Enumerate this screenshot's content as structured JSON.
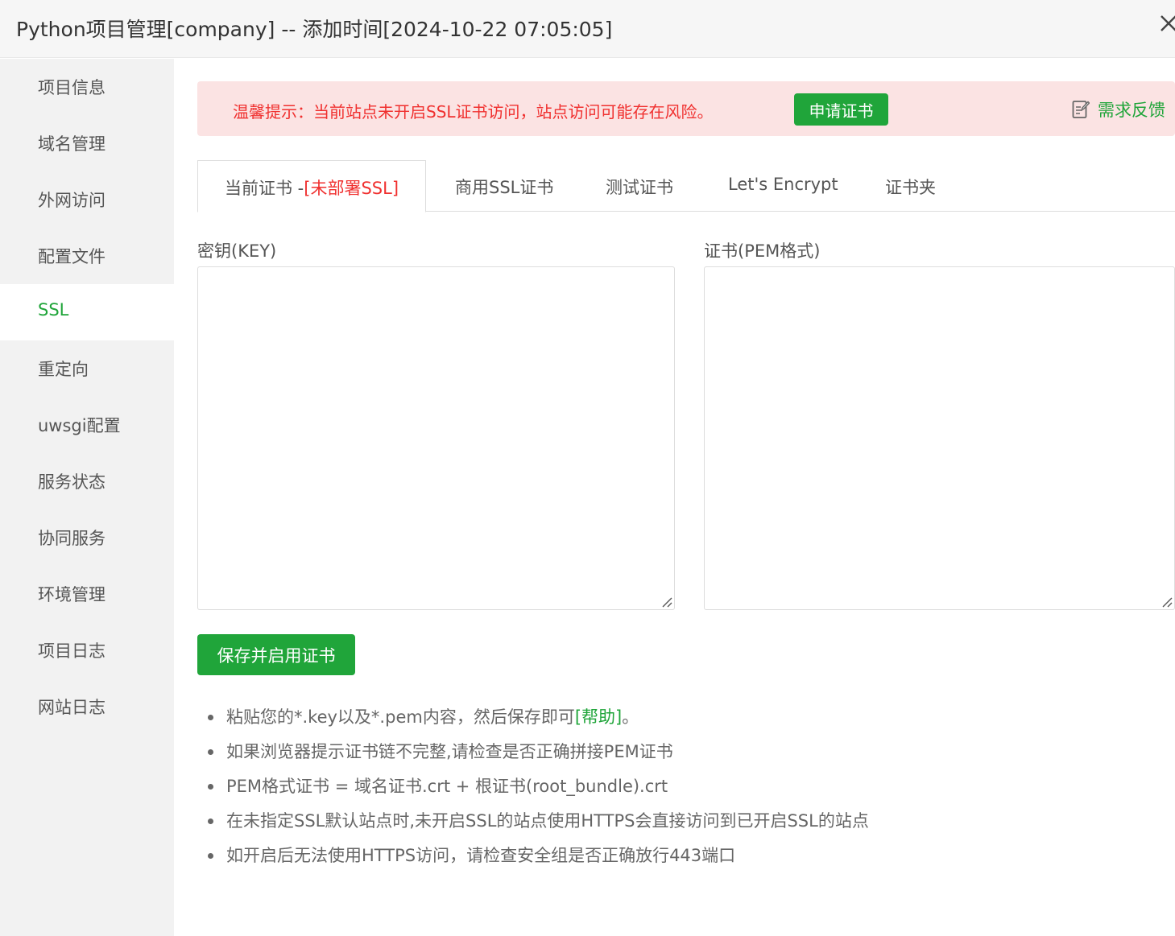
{
  "window": {
    "title": "Python项目管理[company] -- 添加时间[2024-10-22 07:05:05]",
    "close_icon": "close-icon"
  },
  "sidebar": {
    "active": "SSL",
    "items": [
      {
        "label": "项目信息"
      },
      {
        "label": "域名管理"
      },
      {
        "label": "外网访问"
      },
      {
        "label": "配置文件"
      },
      {
        "label": "SSL"
      },
      {
        "label": "重定向"
      },
      {
        "label": "uwsgi配置"
      },
      {
        "label": "服务状态"
      },
      {
        "label": "协同服务"
      },
      {
        "label": "环境管理"
      },
      {
        "label": "项目日志"
      },
      {
        "label": "网站日志"
      }
    ]
  },
  "alert": {
    "text": "温馨提示：当前站点未开启SSL证书访问，站点访问可能存在风险。",
    "apply_button": "申请证书",
    "feedback_label": "需求反馈",
    "feedback_icon": "edit-note-icon"
  },
  "tabs": {
    "current_label": "当前证书 -",
    "current_status": "[未部署SSL]",
    "items": [
      {
        "label": "商用SSL证书"
      },
      {
        "label": "测试证书"
      },
      {
        "label": "Let's Encrypt"
      },
      {
        "label": "证书夹"
      }
    ]
  },
  "form": {
    "key_label": "密钥(KEY)",
    "key_value": "",
    "cert_label": "证书(PEM格式)",
    "cert_value": "",
    "save_button": "保存并启用证书"
  },
  "tips": {
    "tip1_prefix": "粘贴您的*.key以及*.pem内容，然后保存即可",
    "help_link": "[帮助]",
    "tip1_suffix": "。",
    "tip2": "如果浏览器提示证书链不完整,请检查是否正确拼接PEM证书",
    "tip3": "PEM格式证书 = 域名证书.crt + 根证书(root_bundle).crt",
    "tip4": "在未指定SSL默认站点时,未开启SSL的站点使用HTTPS会直接访问到已开启SSL的站点",
    "tip5": "如开启后无法使用HTTPS访问，请检查安全组是否正确放行443端口"
  },
  "colors": {
    "accent": "#20a53a",
    "danger": "#f0302f",
    "alert_bg": "#fbe3e3",
    "sidebar_bg": "#f2f2f2"
  }
}
